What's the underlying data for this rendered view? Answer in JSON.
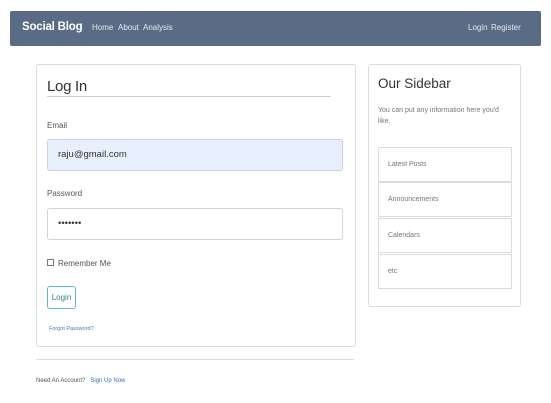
{
  "navbar": {
    "brand": "Social Blog",
    "links": [
      "Home",
      "About",
      "Analysis"
    ],
    "right_links": [
      "Login",
      "Register"
    ]
  },
  "login_form": {
    "title": "Log In",
    "email_label": "Email",
    "email_value": "raju@gmail.com",
    "password_label": "Password",
    "password_value": "•••••••",
    "remember_label": "Remember Me",
    "login_button": "Login",
    "forgot_link": "Forgot Password?"
  },
  "footer": {
    "need_account": "Need An Account?",
    "signup_link": "Sign Up Now"
  },
  "sidebar": {
    "title": "Our Sidebar",
    "text": "You can put any information here you'd like.",
    "items": [
      "Latest Posts",
      "Announcements",
      "Calendars",
      "etc"
    ]
  }
}
